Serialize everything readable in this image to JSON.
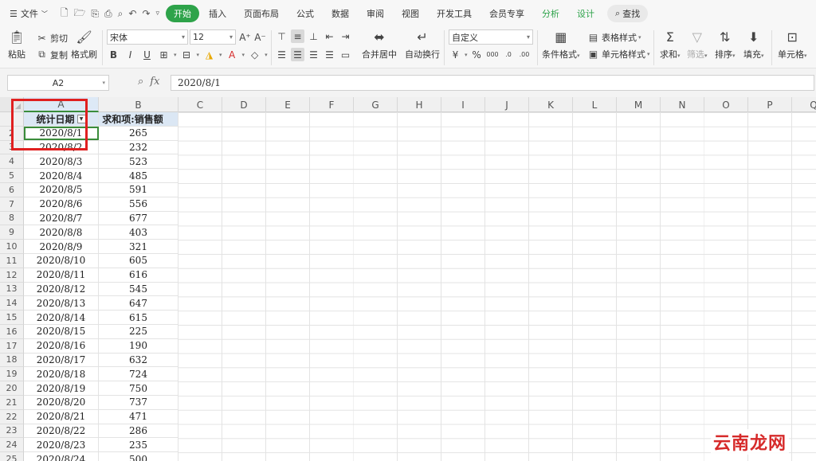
{
  "menubar": {
    "file_label": "文件",
    "tabs": [
      {
        "label": "开始",
        "active": true
      },
      {
        "label": "插入"
      },
      {
        "label": "页面布局"
      },
      {
        "label": "公式"
      },
      {
        "label": "数据"
      },
      {
        "label": "审阅"
      },
      {
        "label": "视图"
      },
      {
        "label": "开发工具"
      },
      {
        "label": "会员专享"
      },
      {
        "label": "分析",
        "green": true
      },
      {
        "label": "设计",
        "green": true
      }
    ],
    "search_label": "查找"
  },
  "ribbon": {
    "paste": "粘贴",
    "cut": "剪切",
    "copy": "复制",
    "format_painter": "格式刷",
    "font_name": "宋体",
    "font_size": "12",
    "merge_center": "合并居中",
    "wrap_text": "自动换行",
    "number_format": "自定义",
    "conditional_format": "条件格式",
    "table_style": "表格样式",
    "cell_style": "单元格样式",
    "sum": "求和",
    "filter": "筛选",
    "sort": "排序",
    "fill": "填充",
    "cell": "单元格"
  },
  "formula_bar": {
    "name_box": "A2",
    "fx": "fx",
    "formula": "2020/8/1"
  },
  "grid": {
    "columns": [
      "A",
      "B",
      "C",
      "D",
      "E",
      "F",
      "G",
      "H",
      "I",
      "J",
      "K",
      "L",
      "M",
      "N",
      "O",
      "P",
      "Q"
    ],
    "header_a": "统计日期",
    "header_b": "求和项:销售额",
    "rows": [
      {
        "num": "2",
        "date": "2020/8/1",
        "value": "265"
      },
      {
        "num": "3",
        "date": "2020/8/2",
        "value": "232"
      },
      {
        "num": "4",
        "date": "2020/8/3",
        "value": "523"
      },
      {
        "num": "5",
        "date": "2020/8/4",
        "value": "485"
      },
      {
        "num": "6",
        "date": "2020/8/5",
        "value": "591"
      },
      {
        "num": "7",
        "date": "2020/8/6",
        "value": "556"
      },
      {
        "num": "8",
        "date": "2020/8/7",
        "value": "677"
      },
      {
        "num": "9",
        "date": "2020/8/8",
        "value": "403"
      },
      {
        "num": "10",
        "date": "2020/8/9",
        "value": "321"
      },
      {
        "num": "11",
        "date": "2020/8/10",
        "value": "605"
      },
      {
        "num": "12",
        "date": "2020/8/11",
        "value": "616"
      },
      {
        "num": "13",
        "date": "2020/8/12",
        "value": "545"
      },
      {
        "num": "14",
        "date": "2020/8/13",
        "value": "647"
      },
      {
        "num": "15",
        "date": "2020/8/14",
        "value": "615"
      },
      {
        "num": "16",
        "date": "2020/8/15",
        "value": "225"
      },
      {
        "num": "17",
        "date": "2020/8/16",
        "value": "190"
      },
      {
        "num": "18",
        "date": "2020/8/17",
        "value": "632"
      },
      {
        "num": "19",
        "date": "2020/8/18",
        "value": "724"
      },
      {
        "num": "20",
        "date": "2020/8/19",
        "value": "750"
      },
      {
        "num": "21",
        "date": "2020/8/20",
        "value": "737"
      },
      {
        "num": "22",
        "date": "2020/8/21",
        "value": "471"
      },
      {
        "num": "23",
        "date": "2020/8/22",
        "value": "286"
      },
      {
        "num": "24",
        "date": "2020/8/23",
        "value": "235"
      },
      {
        "num": "25",
        "date": "2020/8/24",
        "value": "500"
      }
    ]
  },
  "watermark": "云南龙网",
  "colors": {
    "accent_green": "#2ea34a",
    "highlight_red": "#e02020",
    "header_blue": "#dbe7f4"
  }
}
